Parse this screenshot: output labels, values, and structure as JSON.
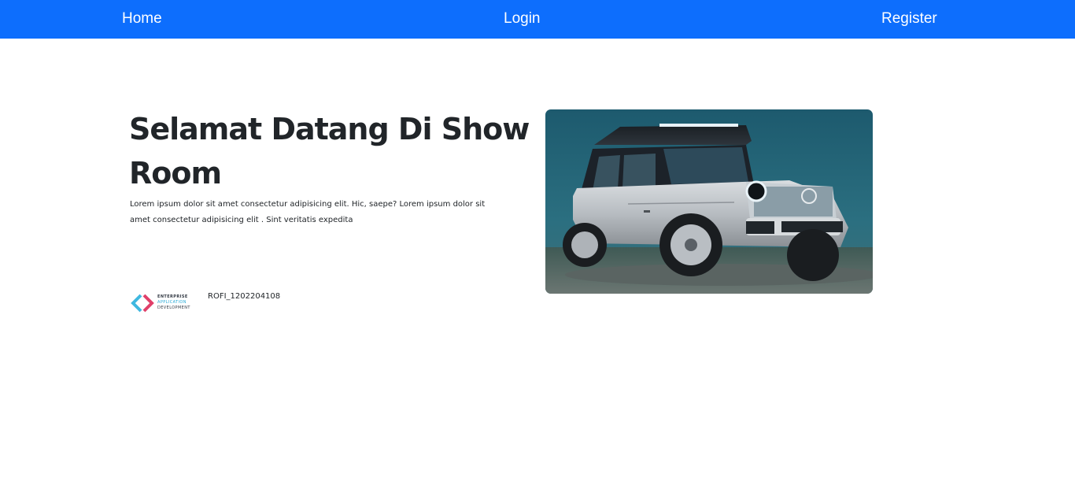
{
  "navbar": {
    "links": [
      {
        "label": "Home"
      },
      {
        "label": "Login"
      },
      {
        "label": "Register"
      }
    ],
    "background_color": "#0d6efd"
  },
  "hero": {
    "title": "Selamat Datang Di Show Room",
    "description": "Lorem ipsum dolor sit amet consectetur adipisicing elit. Hic, saepe? Lorem ipsum dolor sit amet consectetur adipisicing elit . Sint veritatis expedita",
    "image_icon": "car-photo-icon"
  },
  "footer_logo": {
    "line1": "ENTERPRISE",
    "line2": "APPLICATION",
    "line3": "DEVELOPMENT",
    "icon": "code-brackets-icon"
  },
  "author": "ROFI_1202204108"
}
